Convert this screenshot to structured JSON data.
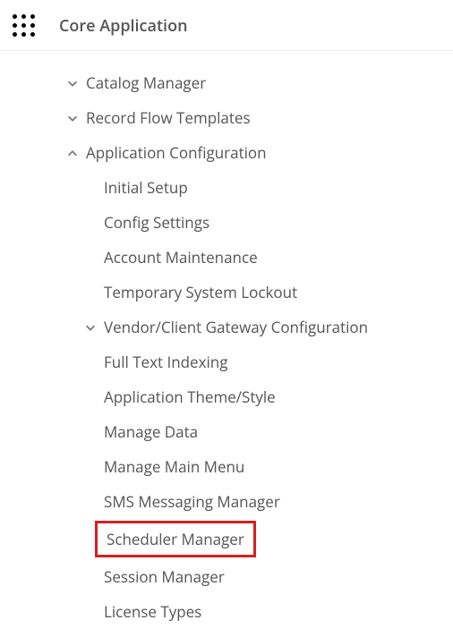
{
  "header": {
    "title": "Core Application"
  },
  "tree": {
    "items": [
      {
        "label": "Catalog Manager",
        "state": "collapsed",
        "level": 1
      },
      {
        "label": "Record Flow Templates",
        "state": "collapsed",
        "level": 1
      },
      {
        "label": "Application Configuration",
        "state": "expanded",
        "level": 1
      },
      {
        "label": "Initial Setup",
        "state": "leaf",
        "level": 2
      },
      {
        "label": "Config Settings",
        "state": "leaf",
        "level": 2
      },
      {
        "label": "Account Maintenance",
        "state": "leaf",
        "level": 2
      },
      {
        "label": "Temporary System Lockout",
        "state": "leaf",
        "level": 2
      },
      {
        "label": "Vendor/Client Gateway Configuration",
        "state": "collapsed",
        "level": 2
      },
      {
        "label": "Full Text Indexing",
        "state": "leaf",
        "level": 2
      },
      {
        "label": "Application Theme/Style",
        "state": "leaf",
        "level": 2
      },
      {
        "label": "Manage Data",
        "state": "leaf",
        "level": 2
      },
      {
        "label": "Manage Main Menu",
        "state": "leaf",
        "level": 2
      },
      {
        "label": "SMS Messaging Manager",
        "state": "leaf",
        "level": 2
      },
      {
        "label": "Scheduler Manager",
        "state": "leaf",
        "level": 2,
        "highlighted": true
      },
      {
        "label": "Session Manager",
        "state": "leaf",
        "level": 2
      },
      {
        "label": "License Types",
        "state": "leaf",
        "level": 2
      }
    ]
  }
}
